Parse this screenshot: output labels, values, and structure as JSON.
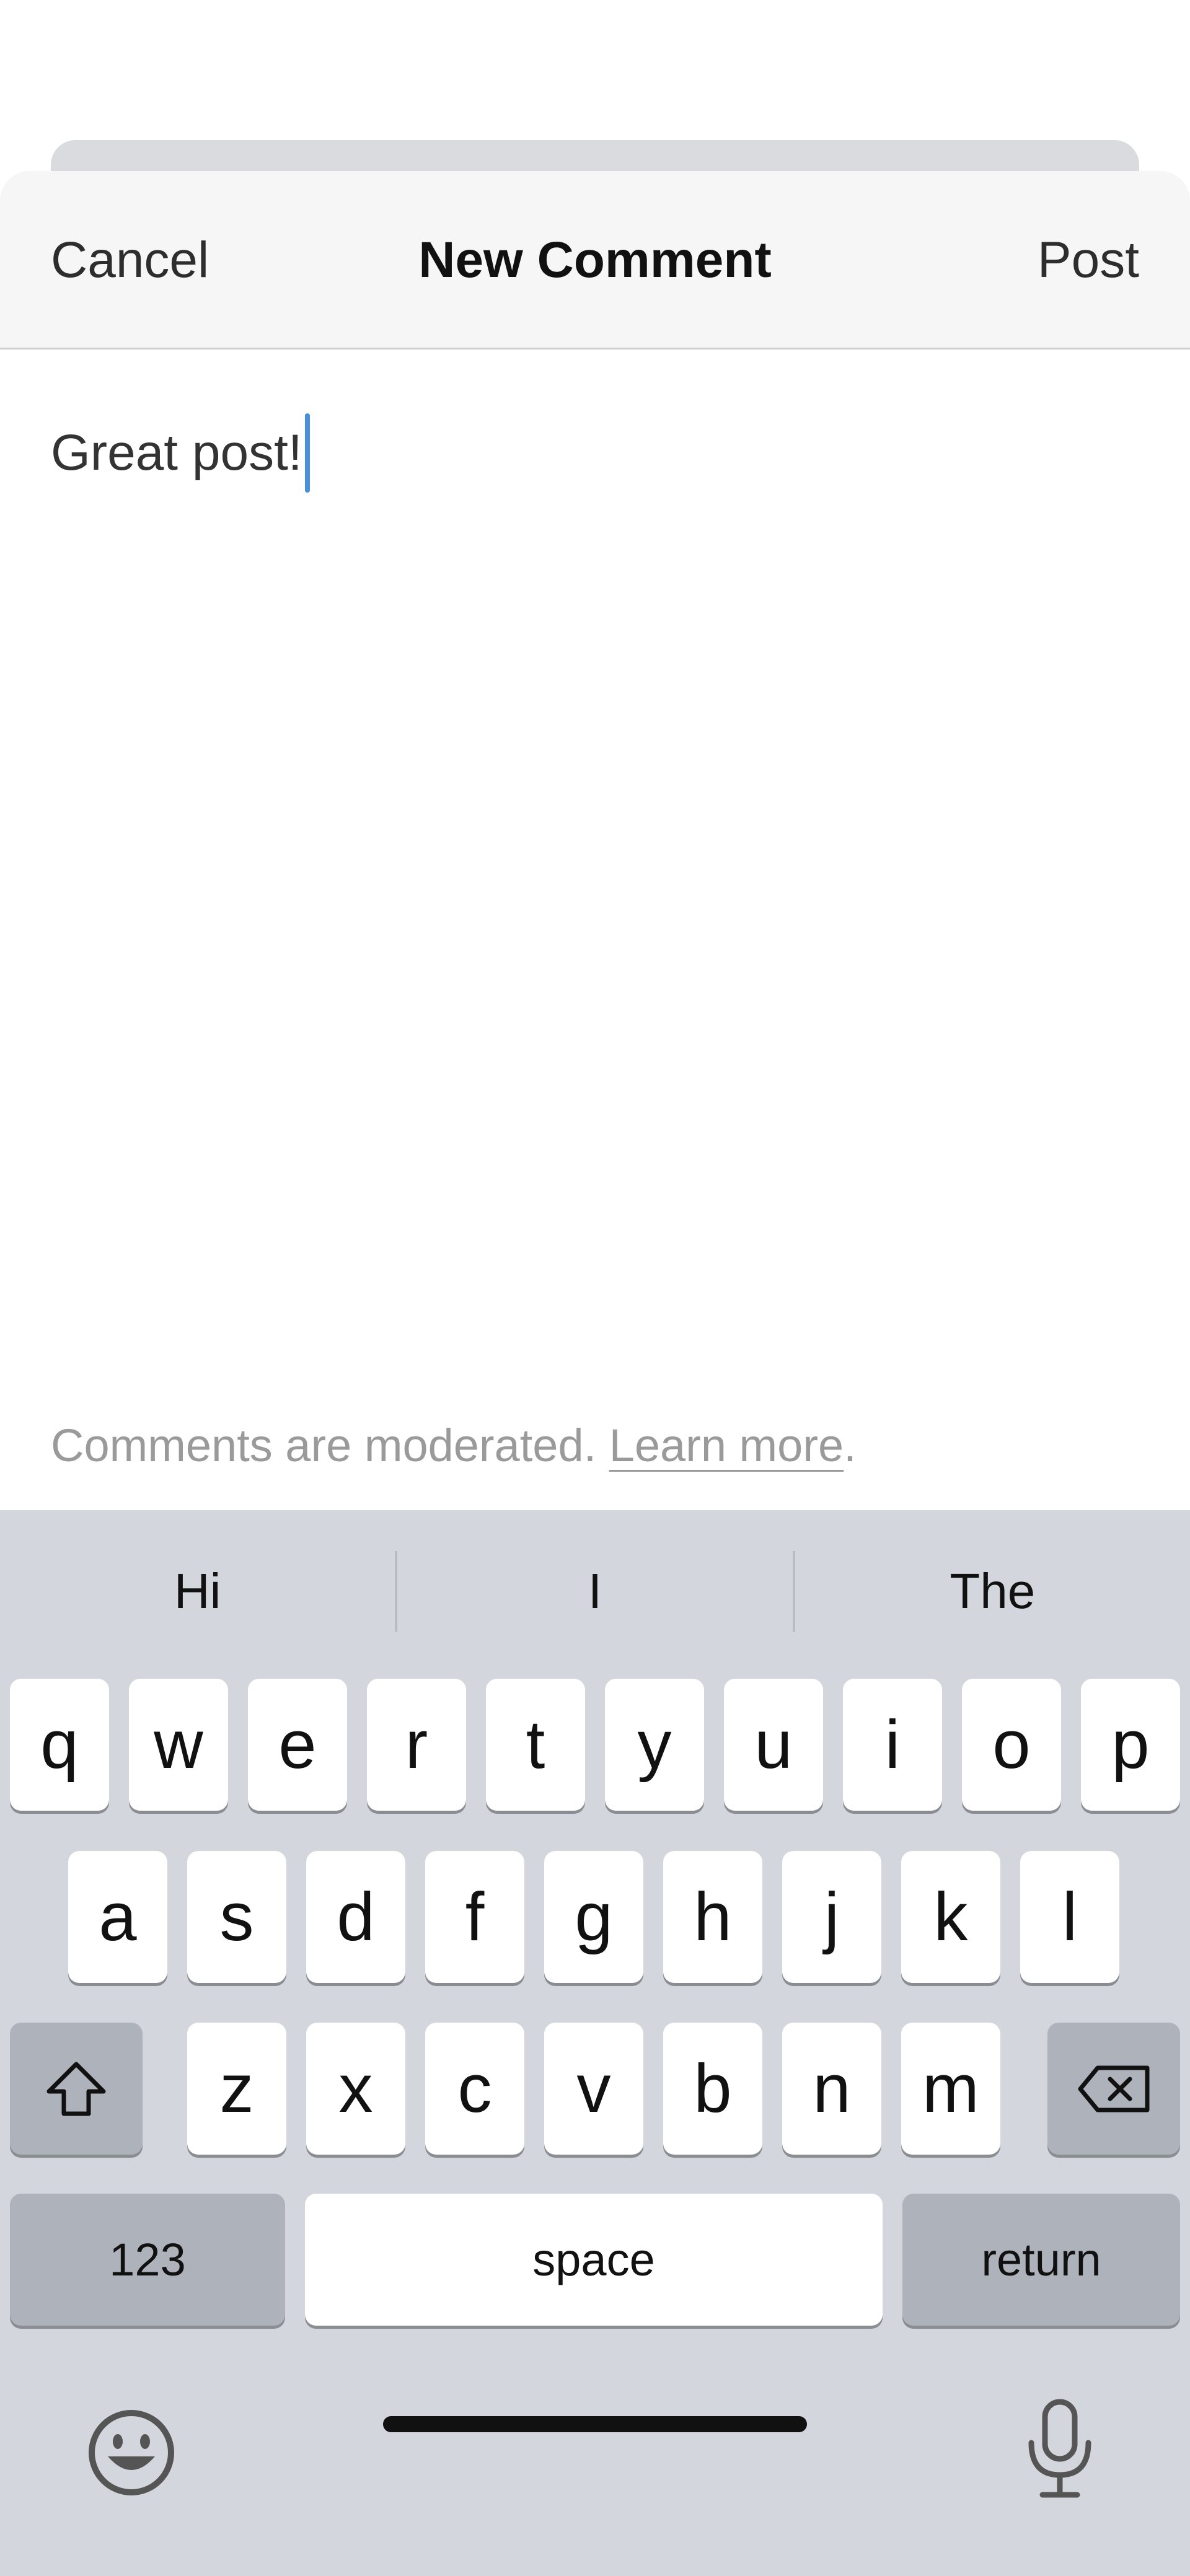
{
  "nav": {
    "cancel_label": "Cancel",
    "title": "New Comment",
    "post_label": "Post"
  },
  "comment": {
    "text": "Great post!"
  },
  "moderation": {
    "prefix": "Comments are moderated. ",
    "link": "Learn more",
    "suffix": "."
  },
  "keyboard": {
    "suggestions": [
      "Hi",
      "I",
      "The"
    ],
    "row1": [
      "q",
      "w",
      "e",
      "r",
      "t",
      "y",
      "u",
      "i",
      "o",
      "p"
    ],
    "row2": [
      "a",
      "s",
      "d",
      "f",
      "g",
      "h",
      "j",
      "k",
      "l"
    ],
    "row3": [
      "z",
      "x",
      "c",
      "v",
      "b",
      "n",
      "m"
    ],
    "numbers_label": "123",
    "space_label": "space",
    "return_label": "return",
    "icons": {
      "shift": "shift-icon",
      "delete": "delete-icon",
      "emoji": "emoji-icon",
      "dictation": "microphone-icon"
    }
  },
  "colors": {
    "caret": "#4a8fd9",
    "keyboard_bg": "#d3d6dc",
    "dark_key": "#adb2bb"
  }
}
